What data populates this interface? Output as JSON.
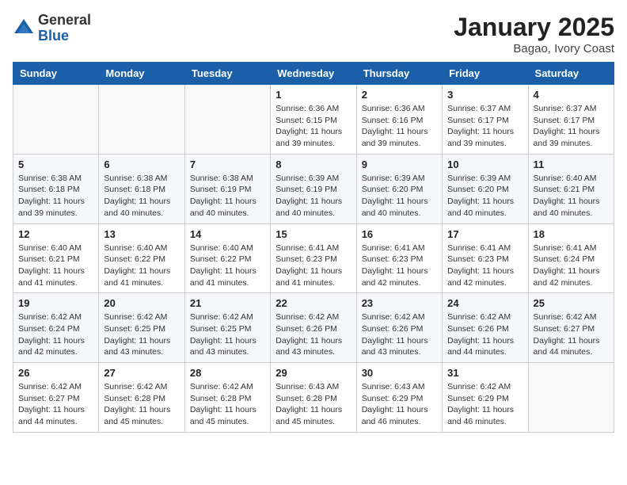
{
  "logo": {
    "general": "General",
    "blue": "Blue"
  },
  "header": {
    "month": "January 2025",
    "location": "Bagao, Ivory Coast"
  },
  "weekdays": [
    "Sunday",
    "Monday",
    "Tuesday",
    "Wednesday",
    "Thursday",
    "Friday",
    "Saturday"
  ],
  "weeks": [
    [
      {
        "day": "",
        "info": ""
      },
      {
        "day": "",
        "info": ""
      },
      {
        "day": "",
        "info": ""
      },
      {
        "day": "1",
        "info": "Sunrise: 6:36 AM\nSunset: 6:15 PM\nDaylight: 11 hours\nand 39 minutes."
      },
      {
        "day": "2",
        "info": "Sunrise: 6:36 AM\nSunset: 6:16 PM\nDaylight: 11 hours\nand 39 minutes."
      },
      {
        "day": "3",
        "info": "Sunrise: 6:37 AM\nSunset: 6:17 PM\nDaylight: 11 hours\nand 39 minutes."
      },
      {
        "day": "4",
        "info": "Sunrise: 6:37 AM\nSunset: 6:17 PM\nDaylight: 11 hours\nand 39 minutes."
      }
    ],
    [
      {
        "day": "5",
        "info": "Sunrise: 6:38 AM\nSunset: 6:18 PM\nDaylight: 11 hours\nand 39 minutes."
      },
      {
        "day": "6",
        "info": "Sunrise: 6:38 AM\nSunset: 6:18 PM\nDaylight: 11 hours\nand 40 minutes."
      },
      {
        "day": "7",
        "info": "Sunrise: 6:38 AM\nSunset: 6:19 PM\nDaylight: 11 hours\nand 40 minutes."
      },
      {
        "day": "8",
        "info": "Sunrise: 6:39 AM\nSunset: 6:19 PM\nDaylight: 11 hours\nand 40 minutes."
      },
      {
        "day": "9",
        "info": "Sunrise: 6:39 AM\nSunset: 6:20 PM\nDaylight: 11 hours\nand 40 minutes."
      },
      {
        "day": "10",
        "info": "Sunrise: 6:39 AM\nSunset: 6:20 PM\nDaylight: 11 hours\nand 40 minutes."
      },
      {
        "day": "11",
        "info": "Sunrise: 6:40 AM\nSunset: 6:21 PM\nDaylight: 11 hours\nand 40 minutes."
      }
    ],
    [
      {
        "day": "12",
        "info": "Sunrise: 6:40 AM\nSunset: 6:21 PM\nDaylight: 11 hours\nand 41 minutes."
      },
      {
        "day": "13",
        "info": "Sunrise: 6:40 AM\nSunset: 6:22 PM\nDaylight: 11 hours\nand 41 minutes."
      },
      {
        "day": "14",
        "info": "Sunrise: 6:40 AM\nSunset: 6:22 PM\nDaylight: 11 hours\nand 41 minutes."
      },
      {
        "day": "15",
        "info": "Sunrise: 6:41 AM\nSunset: 6:23 PM\nDaylight: 11 hours\nand 41 minutes."
      },
      {
        "day": "16",
        "info": "Sunrise: 6:41 AM\nSunset: 6:23 PM\nDaylight: 11 hours\nand 42 minutes."
      },
      {
        "day": "17",
        "info": "Sunrise: 6:41 AM\nSunset: 6:23 PM\nDaylight: 11 hours\nand 42 minutes."
      },
      {
        "day": "18",
        "info": "Sunrise: 6:41 AM\nSunset: 6:24 PM\nDaylight: 11 hours\nand 42 minutes."
      }
    ],
    [
      {
        "day": "19",
        "info": "Sunrise: 6:42 AM\nSunset: 6:24 PM\nDaylight: 11 hours\nand 42 minutes."
      },
      {
        "day": "20",
        "info": "Sunrise: 6:42 AM\nSunset: 6:25 PM\nDaylight: 11 hours\nand 43 minutes."
      },
      {
        "day": "21",
        "info": "Sunrise: 6:42 AM\nSunset: 6:25 PM\nDaylight: 11 hours\nand 43 minutes."
      },
      {
        "day": "22",
        "info": "Sunrise: 6:42 AM\nSunset: 6:26 PM\nDaylight: 11 hours\nand 43 minutes."
      },
      {
        "day": "23",
        "info": "Sunrise: 6:42 AM\nSunset: 6:26 PM\nDaylight: 11 hours\nand 43 minutes."
      },
      {
        "day": "24",
        "info": "Sunrise: 6:42 AM\nSunset: 6:26 PM\nDaylight: 11 hours\nand 44 minutes."
      },
      {
        "day": "25",
        "info": "Sunrise: 6:42 AM\nSunset: 6:27 PM\nDaylight: 11 hours\nand 44 minutes."
      }
    ],
    [
      {
        "day": "26",
        "info": "Sunrise: 6:42 AM\nSunset: 6:27 PM\nDaylight: 11 hours\nand 44 minutes."
      },
      {
        "day": "27",
        "info": "Sunrise: 6:42 AM\nSunset: 6:28 PM\nDaylight: 11 hours\nand 45 minutes."
      },
      {
        "day": "28",
        "info": "Sunrise: 6:42 AM\nSunset: 6:28 PM\nDaylight: 11 hours\nand 45 minutes."
      },
      {
        "day": "29",
        "info": "Sunrise: 6:43 AM\nSunset: 6:28 PM\nDaylight: 11 hours\nand 45 minutes."
      },
      {
        "day": "30",
        "info": "Sunrise: 6:43 AM\nSunset: 6:29 PM\nDaylight: 11 hours\nand 46 minutes."
      },
      {
        "day": "31",
        "info": "Sunrise: 6:42 AM\nSunset: 6:29 PM\nDaylight: 11 hours\nand 46 minutes."
      },
      {
        "day": "",
        "info": ""
      }
    ]
  ]
}
